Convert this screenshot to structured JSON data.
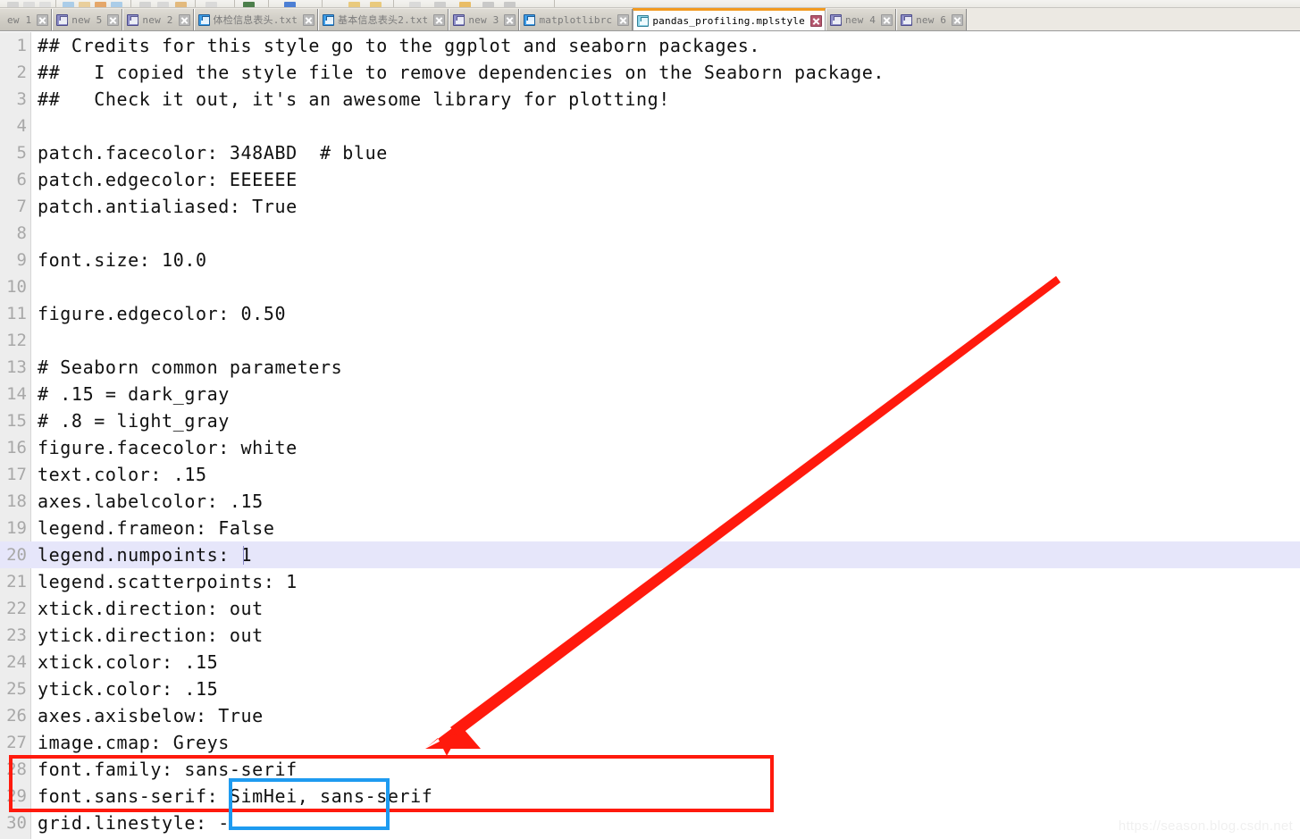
{
  "window": {
    "app": "text-editor",
    "active_file": "pandas_profiling.mplstyle"
  },
  "toolbar": {
    "visible": "partial-strip"
  },
  "tabs": [
    {
      "label": "ew 1",
      "icon": "floppy-disk-icon",
      "icon_color": "purple",
      "active": false,
      "clipped": true
    },
    {
      "label": "new 5",
      "icon": "floppy-disk-icon",
      "icon_color": "purple",
      "active": false
    },
    {
      "label": "new 2",
      "icon": "floppy-disk-icon",
      "icon_color": "purple",
      "active": false
    },
    {
      "label": "体检信息表头.txt",
      "icon": "floppy-disk-icon",
      "icon_color": "blue",
      "active": false
    },
    {
      "label": "基本信息表头2.txt",
      "icon": "floppy-disk-icon",
      "icon_color": "blue",
      "active": false
    },
    {
      "label": "new 3",
      "icon": "floppy-disk-icon",
      "icon_color": "purple",
      "active": false
    },
    {
      "label": "matplotlibrc",
      "icon": "floppy-disk-icon",
      "icon_color": "blue",
      "active": false
    },
    {
      "label": "pandas_profiling.mplstyle",
      "icon": "floppy-disk-icon",
      "icon_color": "green",
      "active": true
    },
    {
      "label": "new 4",
      "icon": "floppy-disk-icon",
      "icon_color": "purple",
      "active": false
    },
    {
      "label": "new 6",
      "icon": "floppy-disk-icon",
      "icon_color": "purple",
      "active": false
    }
  ],
  "editor": {
    "current_line": 20,
    "caret_line": 20,
    "lines": [
      {
        "n": "1",
        "text": "## Credits for this style go to the ggplot and seaborn packages."
      },
      {
        "n": "2",
        "text": "##   I copied the style file to remove dependencies on the Seaborn package."
      },
      {
        "n": "3",
        "text": "##   Check it out, it's an awesome library for plotting!"
      },
      {
        "n": "4",
        "text": ""
      },
      {
        "n": "5",
        "text": "patch.facecolor: 348ABD  # blue"
      },
      {
        "n": "6",
        "text": "patch.edgecolor: EEEEEE"
      },
      {
        "n": "7",
        "text": "patch.antialiased: True"
      },
      {
        "n": "8",
        "text": ""
      },
      {
        "n": "9",
        "text": "font.size: 10.0"
      },
      {
        "n": "10",
        "text": ""
      },
      {
        "n": "11",
        "text": "figure.edgecolor: 0.50"
      },
      {
        "n": "12",
        "text": ""
      },
      {
        "n": "13",
        "text": "# Seaborn common parameters"
      },
      {
        "n": "14",
        "text": "# .15 = dark_gray"
      },
      {
        "n": "15",
        "text": "# .8 = light_gray"
      },
      {
        "n": "16",
        "text": "figure.facecolor: white"
      },
      {
        "n": "17",
        "text": "text.color: .15"
      },
      {
        "n": "18",
        "text": "axes.labelcolor: .15"
      },
      {
        "n": "19",
        "text": "legend.frameon: False"
      },
      {
        "n": "20",
        "text": "legend.numpoints: 1"
      },
      {
        "n": "21",
        "text": "legend.scatterpoints: 1"
      },
      {
        "n": "22",
        "text": "xtick.direction: out"
      },
      {
        "n": "23",
        "text": "ytick.direction: out"
      },
      {
        "n": "24",
        "text": "xtick.color: .15"
      },
      {
        "n": "25",
        "text": "ytick.color: .15"
      },
      {
        "n": "26",
        "text": "axes.axisbelow: True"
      },
      {
        "n": "27",
        "text": "image.cmap: Greys"
      },
      {
        "n": "28",
        "text": "font.family: sans-serif"
      },
      {
        "n": "29",
        "text": "font.sans-serif: SimHei, sans-serif"
      },
      {
        "n": "30",
        "text": "grid.linestyle: -"
      }
    ]
  },
  "annotations": {
    "red_rect": {
      "color": "#ff1a0d",
      "targets": "font.family / font.sans-serif lines"
    },
    "blue_rect": {
      "color": "#1e9bf0",
      "targets": "SimHei value"
    },
    "arrow": {
      "color": "#ff1a0d",
      "from": "1182,311",
      "to": "483,833"
    }
  },
  "watermark": {
    "text": "https://season.blog.csdn.net"
  },
  "colors": {
    "active_tab_accent": "#f29a1f",
    "current_line_highlight": "#e6e6fa",
    "gutter_bg": "#ededed",
    "annotation_red": "#ff1a0d",
    "annotation_blue": "#1e9bf0"
  }
}
